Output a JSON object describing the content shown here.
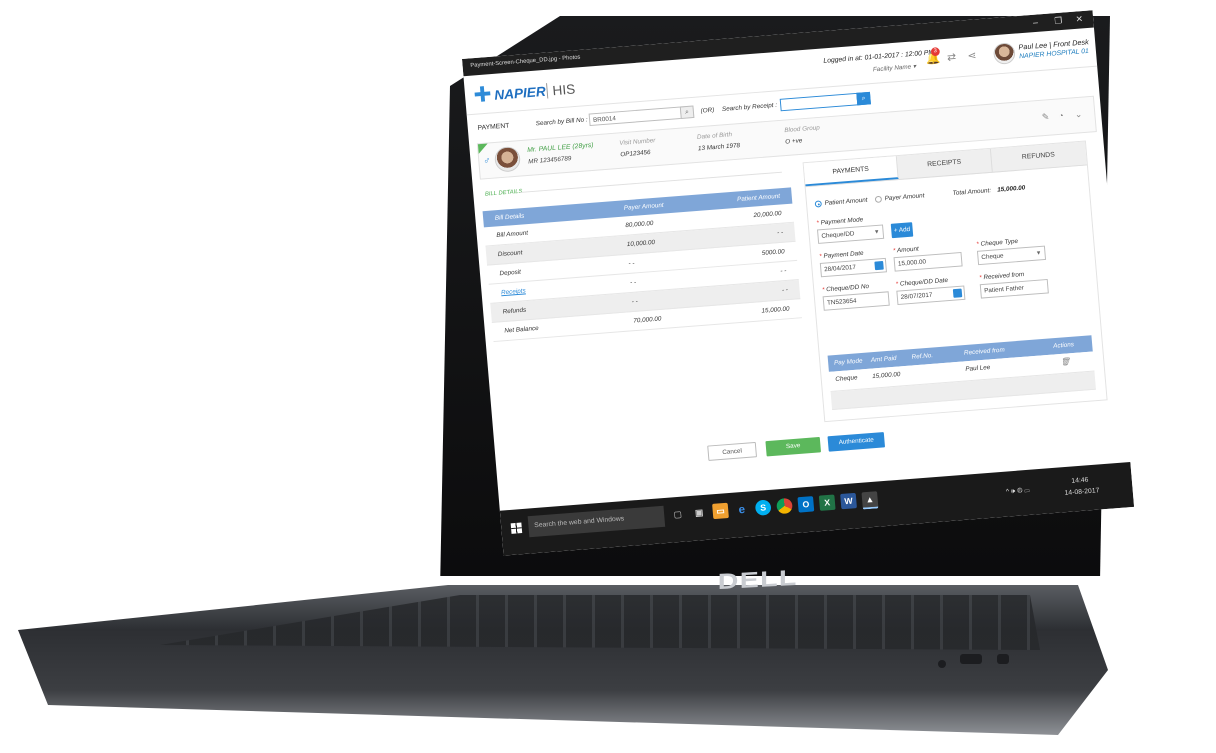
{
  "window": {
    "title": "Payment-Screen-Cheque_DD.jpg - Photos",
    "min": "–",
    "max": "❐",
    "close": "✕"
  },
  "header": {
    "logo": "NAPIER",
    "logo_suffix": "HIS",
    "logged_in": "Logged in at: 01-01-2017 : 12:00 PM",
    "facility": "Facility Name ▾",
    "notification_count": "3",
    "user_name": "Paul Lee | Front Desk",
    "hospital": "NAPIER HOSPITAL 01"
  },
  "search": {
    "section_label": "PAYMENT",
    "bill_label": "Search by Bill No :",
    "bill_value": "BR0014",
    "or_label": "(OR)",
    "receipt_label": "Search by Receipt :",
    "receipt_value": ""
  },
  "patient": {
    "sex": "♂",
    "name": "Mr. PAUL LEE (28yrs)",
    "mr": "MR 123456789",
    "visit_label": "Visit Number",
    "visit_value": "OP123456",
    "dob_label": "Date of Birth",
    "dob_value": "13 March 1978",
    "blood_label": "Blood Group",
    "blood_value": "O +ve"
  },
  "bill": {
    "section_label": "BILL DETAILS",
    "headers": [
      "Bill Details",
      "Payer Amount",
      "Patient Amount"
    ],
    "rows": [
      [
        "Bill Amount",
        "80,000.00",
        "20,000.00"
      ],
      [
        "Discount",
        "10,000.00",
        "- -"
      ],
      [
        "Deposit",
        "- -",
        "5000.00"
      ],
      [
        "Receipts",
        "- -",
        "- -"
      ],
      [
        "Refunds",
        "- -",
        "- -"
      ],
      [
        "Net Balance",
        "70,000.00",
        "15,000.00"
      ]
    ]
  },
  "payments": {
    "tabs": [
      "PAYMENTS",
      "RECEIPTS",
      "REFUNDS"
    ],
    "radio_patient": "Patient Amount",
    "radio_payer": "Payer Amount",
    "total_label": "Total Amount:",
    "total_value": "15,000.00",
    "mode_label": "Payment Mode",
    "mode_value": "Cheque/DD",
    "add_label": "+ Add",
    "date_label": "Payment Date",
    "date_value": "28/04/2017",
    "amount_label": "Amount",
    "amount_value": "15,000.00",
    "cheque_type_label": "Cheque Type",
    "cheque_type_value": "Cheque",
    "cheque_no_label": "Cheque/DD No",
    "cheque_no_value": "TN523654",
    "cheque_date_label": "Cheque/DD Date",
    "cheque_date_value": "28/07/2017",
    "received_label": "Received from",
    "received_value": "Patient Father",
    "table_headers": [
      "Pay Mode",
      "Amt Paid",
      "Ref.No.",
      "Received from",
      "Actions"
    ],
    "table_row": [
      "Cheque",
      "15,000.00",
      "",
      "Paul Lee"
    ]
  },
  "actions": {
    "cancel": "Cancel",
    "save": "Save",
    "authenticate": "Authenticate"
  },
  "taskbar": {
    "search_placeholder": "Search the web and Windows",
    "time": "14:46",
    "date": "14-08-2017",
    "tray_icons": "^ 🕪 ◍ ▭"
  },
  "brand": "DELL"
}
